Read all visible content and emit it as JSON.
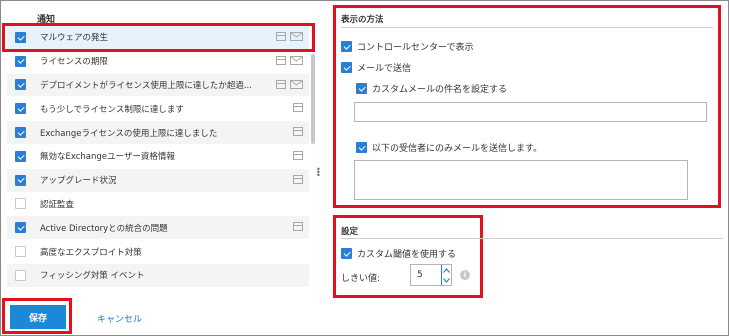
{
  "notifications": {
    "title": "通知",
    "items": [
      {
        "label": "マルウェアの発生",
        "checked": true,
        "selected": true,
        "icons": [
          "window-icon",
          "mail-icon"
        ]
      },
      {
        "label": "ライセンスの期限",
        "checked": true,
        "selected": false,
        "icons": [
          "window-icon",
          "mail-icon"
        ]
      },
      {
        "label": "デプロイメントがライセンス使用上限に達したか超過...",
        "checked": true,
        "selected": false,
        "icons": [
          "window-icon",
          "mail-icon"
        ]
      },
      {
        "label": "もう少しでライセンス制限に達します",
        "checked": true,
        "selected": false,
        "icons": [
          "window-icon"
        ]
      },
      {
        "label": "Exchangeライセンスの使用上限に達しました",
        "checked": true,
        "selected": false,
        "icons": [
          "window-icon"
        ]
      },
      {
        "label": "無効なExchangeユーザー資格情報",
        "checked": true,
        "selected": false,
        "icons": [
          "window-icon"
        ]
      },
      {
        "label": "アップグレード状況",
        "checked": true,
        "selected": false,
        "icons": [
          "window-icon"
        ]
      },
      {
        "label": "認証監査",
        "checked": false,
        "selected": false,
        "icons": []
      },
      {
        "label": "Active Directoryとの統合の問題",
        "checked": true,
        "selected": false,
        "icons": [
          "window-icon"
        ]
      },
      {
        "label": "高度なエクスプロイト対策",
        "checked": false,
        "selected": false,
        "icons": []
      },
      {
        "label": "フィッシング対策 イベント",
        "checked": false,
        "selected": false,
        "icons": []
      }
    ]
  },
  "display": {
    "title": "表示の方法",
    "show_in_control_center": "コントロールセンターで表示",
    "send_email": "メールで送信",
    "custom_subject": "カスタムメールの件名を設定する",
    "subject_value": "",
    "only_recipients": "以下の受信者にのみメールを送信します。",
    "recipients_value": ""
  },
  "settings": {
    "title": "設定",
    "use_custom_threshold": "カスタム閾値を使用する",
    "threshold_label": "しきい値:",
    "threshold_value": "5",
    "info_symbol": "i"
  },
  "footer": {
    "save_label": "保存",
    "cancel_label": "キャンセル"
  },
  "colors": {
    "accent": "#2a7fd4",
    "highlight_border": "#e3111b",
    "selected_row": "#e6f3fc"
  }
}
